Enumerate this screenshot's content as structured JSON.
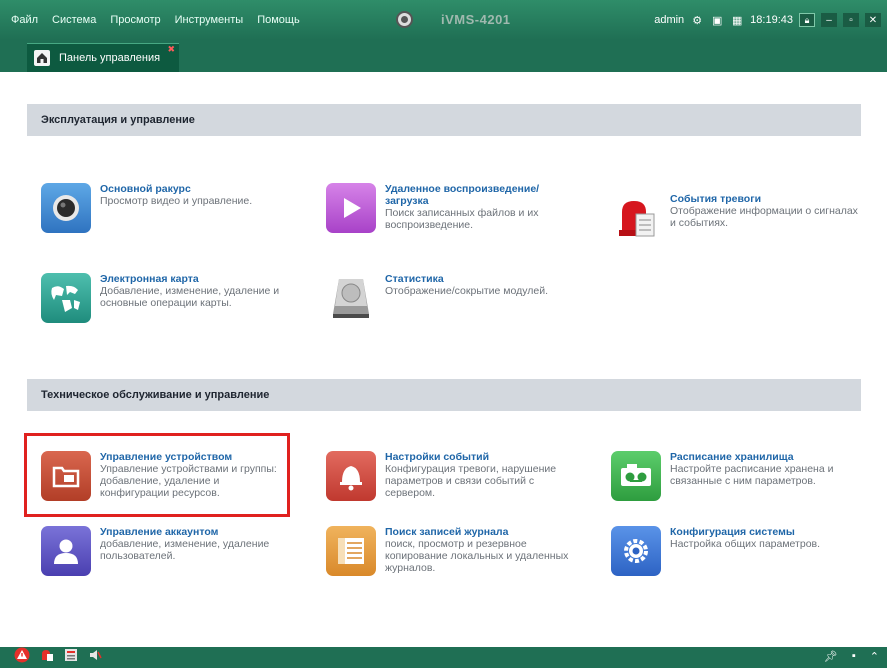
{
  "menu": [
    "Файл",
    "Система",
    "Просмотр",
    "Инструменты",
    "Помощь"
  ],
  "app_title": "iVMS-4201",
  "user": "admin",
  "clock": "18:19:43",
  "tab_label": "Панель управления",
  "section1_title": "Эксплуатация и управление",
  "section2_title": "Техническое обслуживание и управление",
  "items": {
    "main_view": {
      "title": "Основной ракурс",
      "desc": "Просмотр видео и управление."
    },
    "remote_playback": {
      "title": "Удаленное воспроизведение/загрузка",
      "desc": "Поиск записанных файлов и их воспроизведение."
    },
    "alarm_events": {
      "title": "События тревоги",
      "desc": "Отображение информации о сигналах и событиях."
    },
    "emap": {
      "title": "Электронная карта",
      "desc": "Добавление, изменение, удаление и основные операции карты."
    },
    "statistics": {
      "title": "Статистика",
      "desc": "Отображение/сокрытие модулей."
    },
    "device_management": {
      "title": "Управление устройством",
      "desc": "Управление устройствами и группы: добавление, удаление и конфигурации ресурсов."
    },
    "event_settings": {
      "title": "Настройки событий",
      "desc": "Конфигурация тревоги, нарушение параметров и связи событий с сервером."
    },
    "storage_schedule": {
      "title": "Расписание хранилища",
      "desc": "Настройте расписание хранена и связанные с ним параметров."
    },
    "account_management": {
      "title": "Управление аккаунтом",
      "desc": "добавление, изменение, удаление пользователей."
    },
    "log_search": {
      "title": "Поиск записей журнала",
      "desc": "поиск, просмотр и резервное копирование локальных и удаленных журналов."
    },
    "system_config": {
      "title": "Конфигурация системы",
      "desc": "Настройка общих параметров."
    }
  },
  "colors": {
    "accent_green": "#1f6f54",
    "highlight_red": "#e0211f",
    "link_blue": "#1f66a8"
  }
}
